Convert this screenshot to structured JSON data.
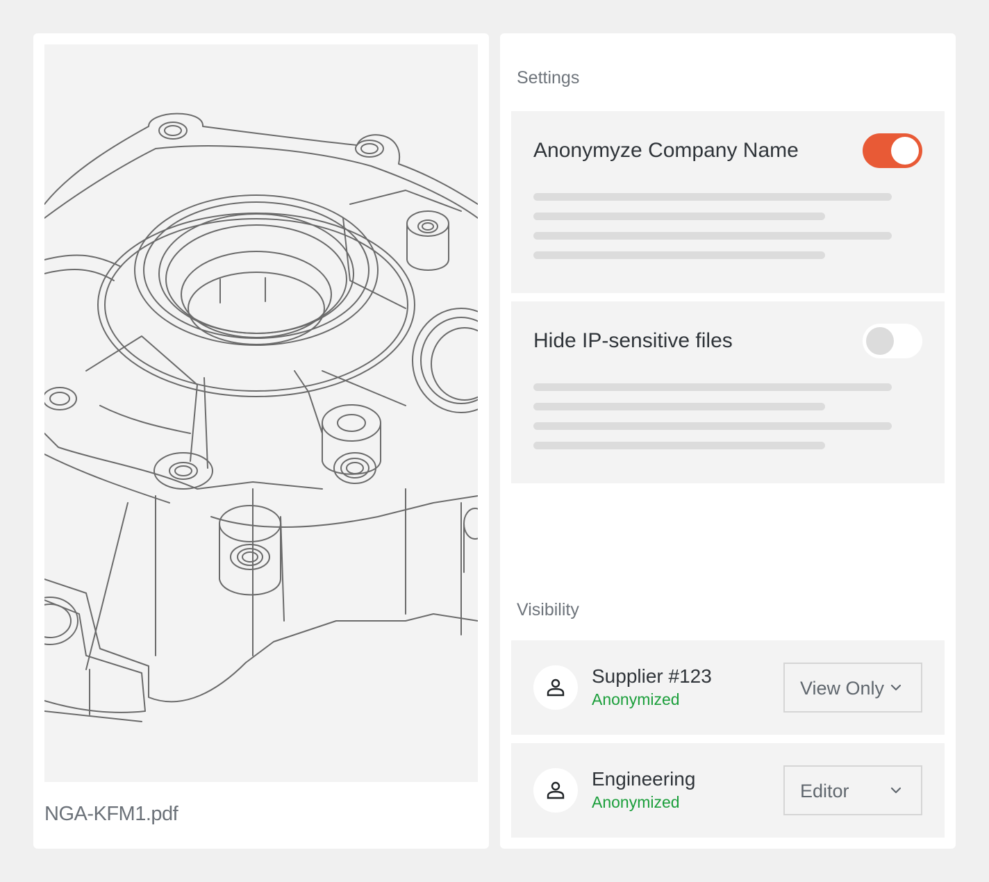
{
  "file": {
    "name": "NGA-KFM1.pdf"
  },
  "settings": {
    "title": "Settings",
    "options": [
      {
        "label": "Anonymyze Company Name",
        "enabled": true
      },
      {
        "label": "Hide IP-sensitive files",
        "enabled": false
      }
    ]
  },
  "visibility": {
    "title": "Visibility",
    "members": [
      {
        "name": "Supplier #123",
        "status": "Anonymized",
        "role": "View Only"
      },
      {
        "name": "Engineering",
        "status": "Anonymized",
        "role": "Editor"
      }
    ]
  },
  "colors": {
    "toggle_on": "#e85a36",
    "status_green": "#1a9e3a"
  },
  "icons": {
    "avatar": "user-icon",
    "dropdown": "chevron-down-icon"
  }
}
